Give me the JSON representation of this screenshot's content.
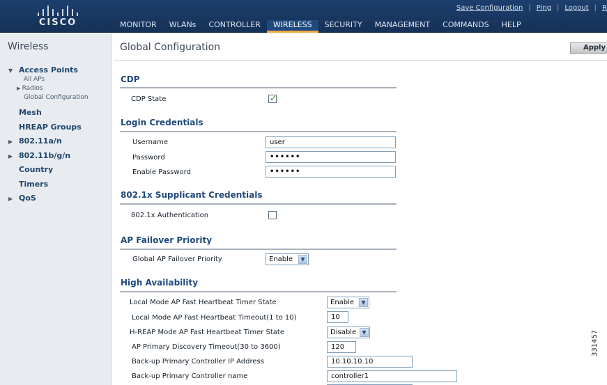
{
  "header": {
    "brand": "CISCO",
    "top_links": [
      "Save Configuration",
      "Ping",
      "Logout",
      "R"
    ],
    "nav": [
      "MONITOR",
      "WLANs",
      "CONTROLLER",
      "WIRELESS",
      "SECURITY",
      "MANAGEMENT",
      "COMMANDS",
      "HELP"
    ],
    "active_nav": "WIRELESS"
  },
  "sidebar": {
    "title": "Wireless",
    "access_points": {
      "label": "Access Points",
      "children": [
        "All APs",
        "Radios",
        "Global Configuration"
      ]
    },
    "items": [
      "Mesh",
      "HREAP Groups",
      "802.11a/n",
      "802.11b/g/n",
      "Country",
      "Timers",
      "QoS"
    ]
  },
  "main": {
    "title": "Global Configuration",
    "apply_label": "Apply",
    "cdp": {
      "heading": "CDP",
      "state_label": "CDP State",
      "state_checked": true
    },
    "login": {
      "heading": "Login Credentials",
      "username_label": "Username",
      "username_value": "user",
      "password_label": "Password",
      "password_value": "••••••",
      "enable_password_label": "Enable Password",
      "enable_password_value": "••••••"
    },
    "supplicant": {
      "heading": "802.1x Supplicant Credentials",
      "auth_label": "802.1x Authentication",
      "auth_checked": false
    },
    "failover": {
      "heading": "AP Failover Priority",
      "priority_label": "Global AP Failover Priority",
      "priority_value": "Enable"
    },
    "ha": {
      "heading": "High Availability",
      "local_state_label": "Local Mode AP Fast Heartbeat Timer State",
      "local_state_value": "Enable",
      "local_timeout_label": "Local Mode AP Fast Heartbeat Timeout(1 to 10)",
      "local_timeout_value": "10",
      "hreap_state_label": "H-REAP Mode AP Fast Heartbeat Timer State",
      "hreap_state_value": "Disable",
      "discovery_label": "AP Primary Discovery Timeout(30 to 3600)",
      "discovery_value": "120",
      "backup_ip_label": "Back-up Primary Controller IP Address",
      "backup_ip_value": "10.10.10.10",
      "backup_name_label": "Back-up Primary Controller name",
      "backup_name_value": "controller1"
    }
  },
  "figure_id": "331457"
}
